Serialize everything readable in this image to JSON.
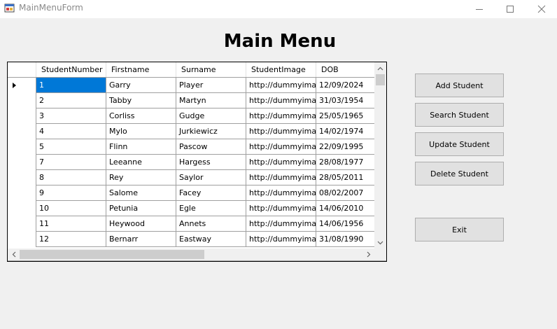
{
  "window": {
    "title": "MainMenuForm",
    "minimize_glyph": "—",
    "maximize_glyph": "☐",
    "close_glyph": "✕"
  },
  "heading": "Main Menu",
  "grid": {
    "columns": [
      "StudentNumber",
      "Firstname",
      "Surname",
      "StudentImage",
      "DOB"
    ],
    "rows": [
      [
        "1",
        "Garry",
        "Player",
        "http://dummyima...",
        "12/09/2024"
      ],
      [
        "2",
        "Tabby",
        "Martyn",
        "http://dummyima...",
        "31/03/1954"
      ],
      [
        "3",
        "Corliss",
        "Gudge",
        "http://dummyima...",
        "25/05/1965"
      ],
      [
        "4",
        "Mylo",
        "Jurkiewicz",
        "http://dummyima...",
        "14/02/1974"
      ],
      [
        "5",
        "Flinn",
        "Pascow",
        "http://dummyima...",
        "22/09/1995"
      ],
      [
        "7",
        "Leeanne",
        "Hargess",
        "http://dummyima...",
        "28/08/1977"
      ],
      [
        "8",
        "Rey",
        "Saylor",
        "http://dummyima...",
        "28/05/2011"
      ],
      [
        "9",
        "Salome",
        "Facey",
        "http://dummyima...",
        "08/02/2007"
      ],
      [
        "10",
        "Petunia",
        "Egle",
        "http://dummyima...",
        "14/06/2010"
      ],
      [
        "11",
        "Heywood",
        "Annets",
        "http://dummyima...",
        "14/06/1956"
      ],
      [
        "12",
        "Bernarr",
        "Eastway",
        "http://dummyima...",
        "31/08/1990"
      ]
    ],
    "selected_row": 0,
    "selected_col": 0
  },
  "buttons": {
    "add": "Add Student",
    "search": "Search Student",
    "update": "Update Student",
    "delete": "Delete Student",
    "exit": "Exit"
  },
  "colors": {
    "selection": "#0078d7",
    "button_bg": "#e1e1e1",
    "window_bg": "#f0f0f0"
  }
}
